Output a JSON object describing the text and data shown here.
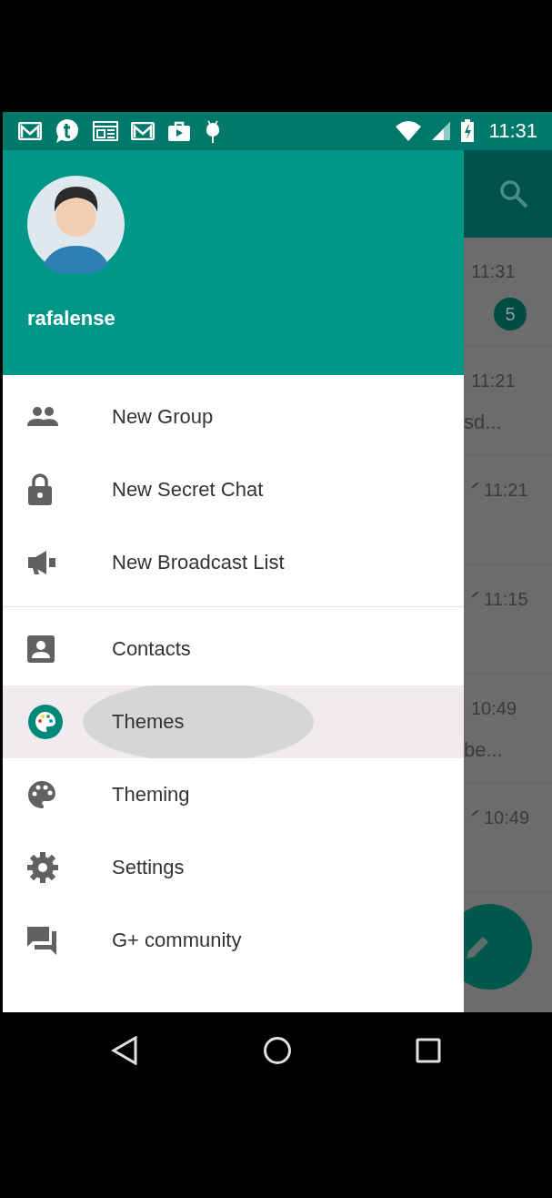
{
  "status_bar": {
    "time": "11:31"
  },
  "drawer": {
    "user_name": "rafalense",
    "sections": [
      [
        {
          "label": "New Group",
          "selected": false
        },
        {
          "label": "New Secret Chat",
          "selected": false
        },
        {
          "label": "New Broadcast List",
          "selected": false
        }
      ],
      [
        {
          "label": "Contacts",
          "selected": false
        },
        {
          "label": "Themes",
          "selected": true
        },
        {
          "label": "Theming",
          "selected": false
        },
        {
          "label": "Settings",
          "selected": false
        },
        {
          "label": "G+ community",
          "selected": false
        }
      ]
    ]
  },
  "chat_list": [
    {
      "time": "11:31",
      "badge": "5",
      "sent": false
    },
    {
      "time": "11:21",
      "preview": "sd...",
      "sent": false
    },
    {
      "time": "11:21",
      "sent": true
    },
    {
      "time": "11:15",
      "sent": true
    },
    {
      "time": "10:49",
      "preview": "be...",
      "sent": false
    },
    {
      "time": "10:49",
      "sent": true
    }
  ]
}
